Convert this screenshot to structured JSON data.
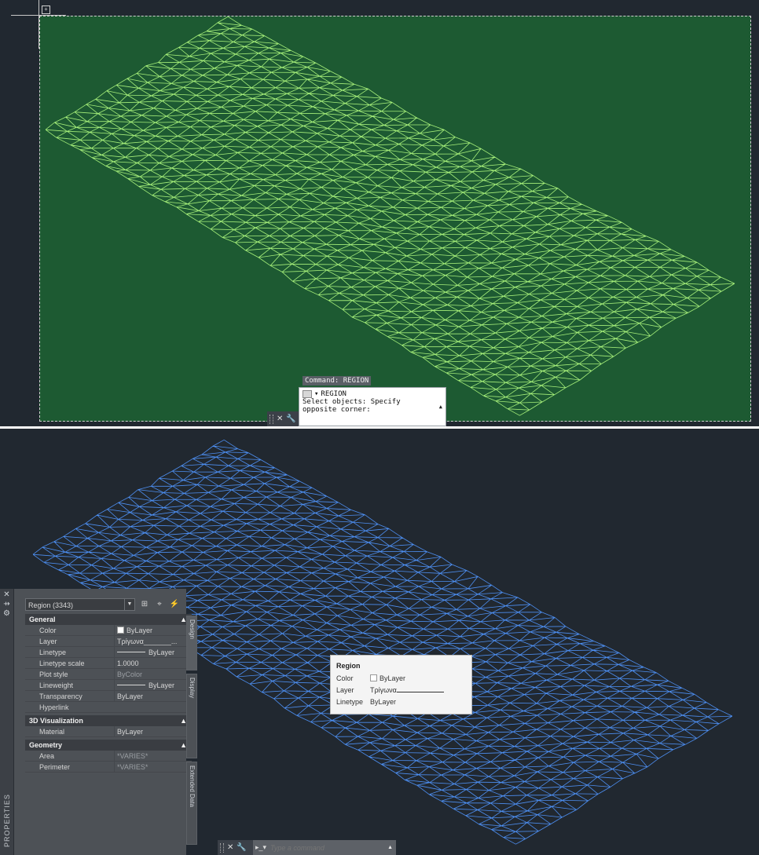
{
  "colors": {
    "background": "#212830",
    "selection_fill": "#1d5a32",
    "mesh_highlight": "#a6f07a",
    "mesh_selected": "#4d8ff2"
  },
  "top_view": {
    "command_echo": "Command: REGION",
    "history_command": "REGION",
    "history_prompt": "Select objects: Specify opposite corner:",
    "history_icon": "command-icon"
  },
  "properties": {
    "palette_title": "PROPERTIES",
    "object_selector": "Region (3343)",
    "toolbar_icons": [
      "toggle-pickadd-icon",
      "select-objects-icon",
      "quick-select-icon"
    ],
    "sections": {
      "general": {
        "title": "General",
        "rows": [
          {
            "label": "Color",
            "value": "ByLayer"
          },
          {
            "label": "Layer",
            "value": "Τρίγωνα_______..."
          },
          {
            "label": "Linetype",
            "value": "ByLayer"
          },
          {
            "label": "Linetype scale",
            "value": "1.0000"
          },
          {
            "label": "Plot style",
            "value": "ByColor"
          },
          {
            "label": "Lineweight",
            "value": "ByLayer"
          },
          {
            "label": "Transparency",
            "value": "ByLayer"
          },
          {
            "label": "Hyperlink",
            "value": ""
          }
        ]
      },
      "visualization": {
        "title": "3D Visualization",
        "rows": [
          {
            "label": "Material",
            "value": "ByLayer"
          }
        ]
      },
      "geometry": {
        "title": "Geometry",
        "rows": [
          {
            "label": "Area",
            "value": "*VARIES*"
          },
          {
            "label": "Perimeter",
            "value": "*VARIES*"
          }
        ]
      }
    },
    "tabs": [
      "Design",
      "Display",
      "Extended Data"
    ]
  },
  "tooltip": {
    "title": "Region",
    "rows": [
      {
        "label": "Color",
        "value": "ByLayer"
      },
      {
        "label": "Layer",
        "value": "Τρίγωνα"
      },
      {
        "label": "Linetype",
        "value": "ByLayer"
      }
    ]
  },
  "command_line": {
    "placeholder": "Type a command",
    "prompt_icon": "command-prompt-icon"
  }
}
